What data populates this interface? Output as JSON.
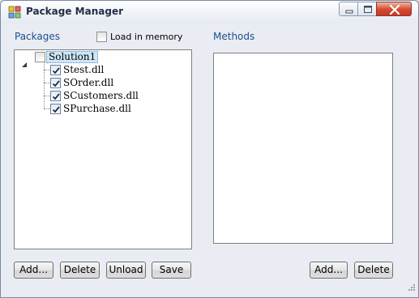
{
  "window": {
    "title": "Package Manager",
    "icon": "package-app-icon",
    "controls": [
      "minimize-icon",
      "maximize-icon",
      "close-icon"
    ]
  },
  "packages": {
    "label": "Packages",
    "load_in_memory": {
      "label": "Load in memory",
      "checked": false
    },
    "tree": {
      "root": {
        "label": "Solution1",
        "checked": false,
        "expanded": true,
        "selected": true
      },
      "children": [
        {
          "label": "Stest.dll",
          "checked": true
        },
        {
          "label": "SOrder.dll",
          "checked": true
        },
        {
          "label": "SCustomers.dll",
          "checked": true
        },
        {
          "label": "SPurchase.dll",
          "checked": true
        }
      ]
    },
    "buttons": {
      "add": "Add...",
      "delete": "Delete",
      "unload": "Unload",
      "save": "Save"
    }
  },
  "methods": {
    "label": "Methods",
    "items": [],
    "buttons": {
      "add": "Add...",
      "delete": "Delete"
    }
  },
  "colors": {
    "group_label": "#1f4e8c",
    "selection": "#cde6f7",
    "close_button": "#c8382a"
  }
}
